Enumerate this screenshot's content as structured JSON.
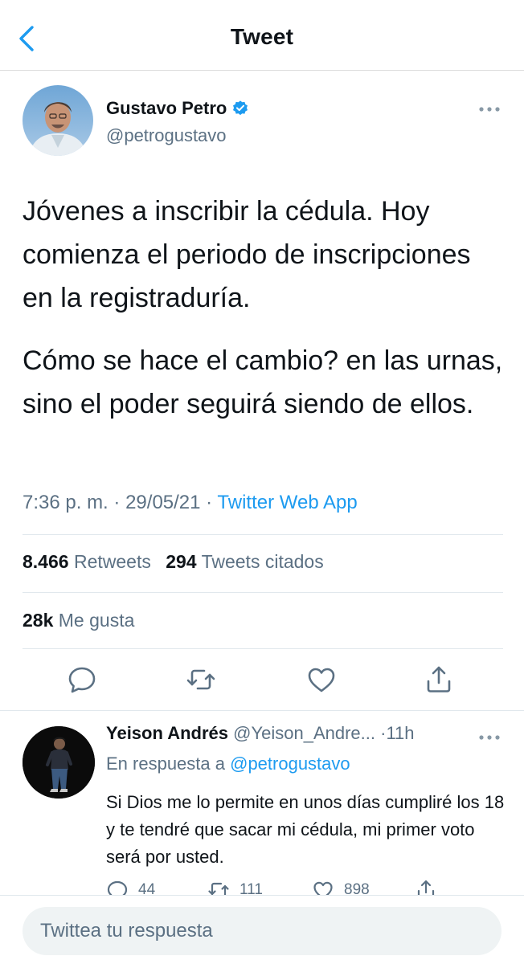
{
  "header": {
    "title": "Tweet",
    "back_icon": "chevron-left-icon"
  },
  "tweet": {
    "author_name": "Gustavo Petro",
    "author_handle": "@petrogustavo",
    "verified": true,
    "paragraphs": [
      "Jóvenes a inscribir la cédula. Hoy comienza el periodo de inscripciones en la registraduría.",
      "Cómo se hace el cambio? en las urnas, sino el poder seguirá siendo de ellos."
    ],
    "time": "7:36 p. m.",
    "date": "29/05/21",
    "separator": "·",
    "source": "Twitter Web App",
    "retweets_count": "8.466",
    "retweets_label": "Retweets",
    "quotes_count": "294",
    "quotes_label": "Tweets citados",
    "likes_count": "28k",
    "likes_label": "Me gusta",
    "actions": [
      "reply-icon",
      "retweet-icon",
      "like-icon",
      "share-icon"
    ]
  },
  "reply": {
    "author_name": "Yeison Andrés",
    "author_handle": "@Yeison_Andre...",
    "separator": "·",
    "time": "11h",
    "in_reply_to_prefix": "En respuesta a",
    "in_reply_to_handle": "@petrogustavo",
    "text": "Si Dios me lo permite en unos días cumpliré los 18 y te tendré que sacar mi cédula, mi primer voto será por usted.",
    "replies_count": "44",
    "retweets_count": "111",
    "likes_count": "898"
  },
  "compose": {
    "placeholder": "Twittea tu respuesta"
  },
  "colors": {
    "accent": "#1d9bf0",
    "secondary_text": "#5b7083",
    "divider": "#e1e8ed"
  }
}
